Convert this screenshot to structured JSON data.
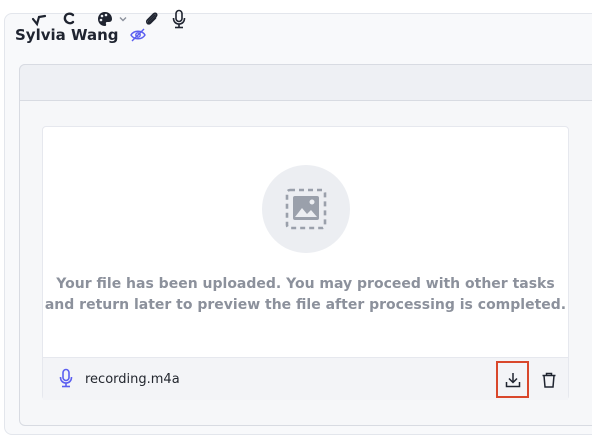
{
  "user": {
    "name": "Sylvia Wang",
    "visibility_icon": "eye-slash-icon",
    "accent_color": "#5b5ef0"
  },
  "toolbar": {
    "icons": [
      "checkmark-icon",
      "c-icon",
      "palette-icon",
      "chevron-down-icon",
      "paperclip-icon",
      "microphone-icon"
    ]
  },
  "upload": {
    "placeholder_icon": "image-placeholder-icon",
    "message_line1": "Your file has been uploaded. You may proceed with other tasks",
    "message_line2": "and return later to preview the file after processing is completed."
  },
  "file": {
    "name": "recording.m4a",
    "type_icon": "microphone-icon",
    "actions": [
      "download-icon",
      "trash-icon"
    ],
    "highlight_color": "#d9472b"
  }
}
